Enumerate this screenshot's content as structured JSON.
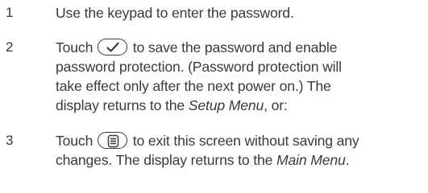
{
  "steps": [
    {
      "number": "1",
      "lines": [
        {
          "text": "Use the keypad to enter the password."
        }
      ]
    },
    {
      "number": "2",
      "icon": "checkmark-button-icon",
      "line1_before": "Touch",
      "line1_after": "to save the password and enable",
      "line2": "password protection. (Password protection will",
      "line3": "take effect only after the next power on.) The",
      "line4_before": "display returns to the",
      "line4_em": "Setup Menu",
      "line4_after": ", or:"
    },
    {
      "number": "3",
      "icon": "menu-button-icon",
      "line1_before": "Touch",
      "line1_after": "to exit this screen without saving any",
      "line2_before": "changes. The display returns to the",
      "line2_em": "Main Menu",
      "line2_after": "."
    }
  ]
}
